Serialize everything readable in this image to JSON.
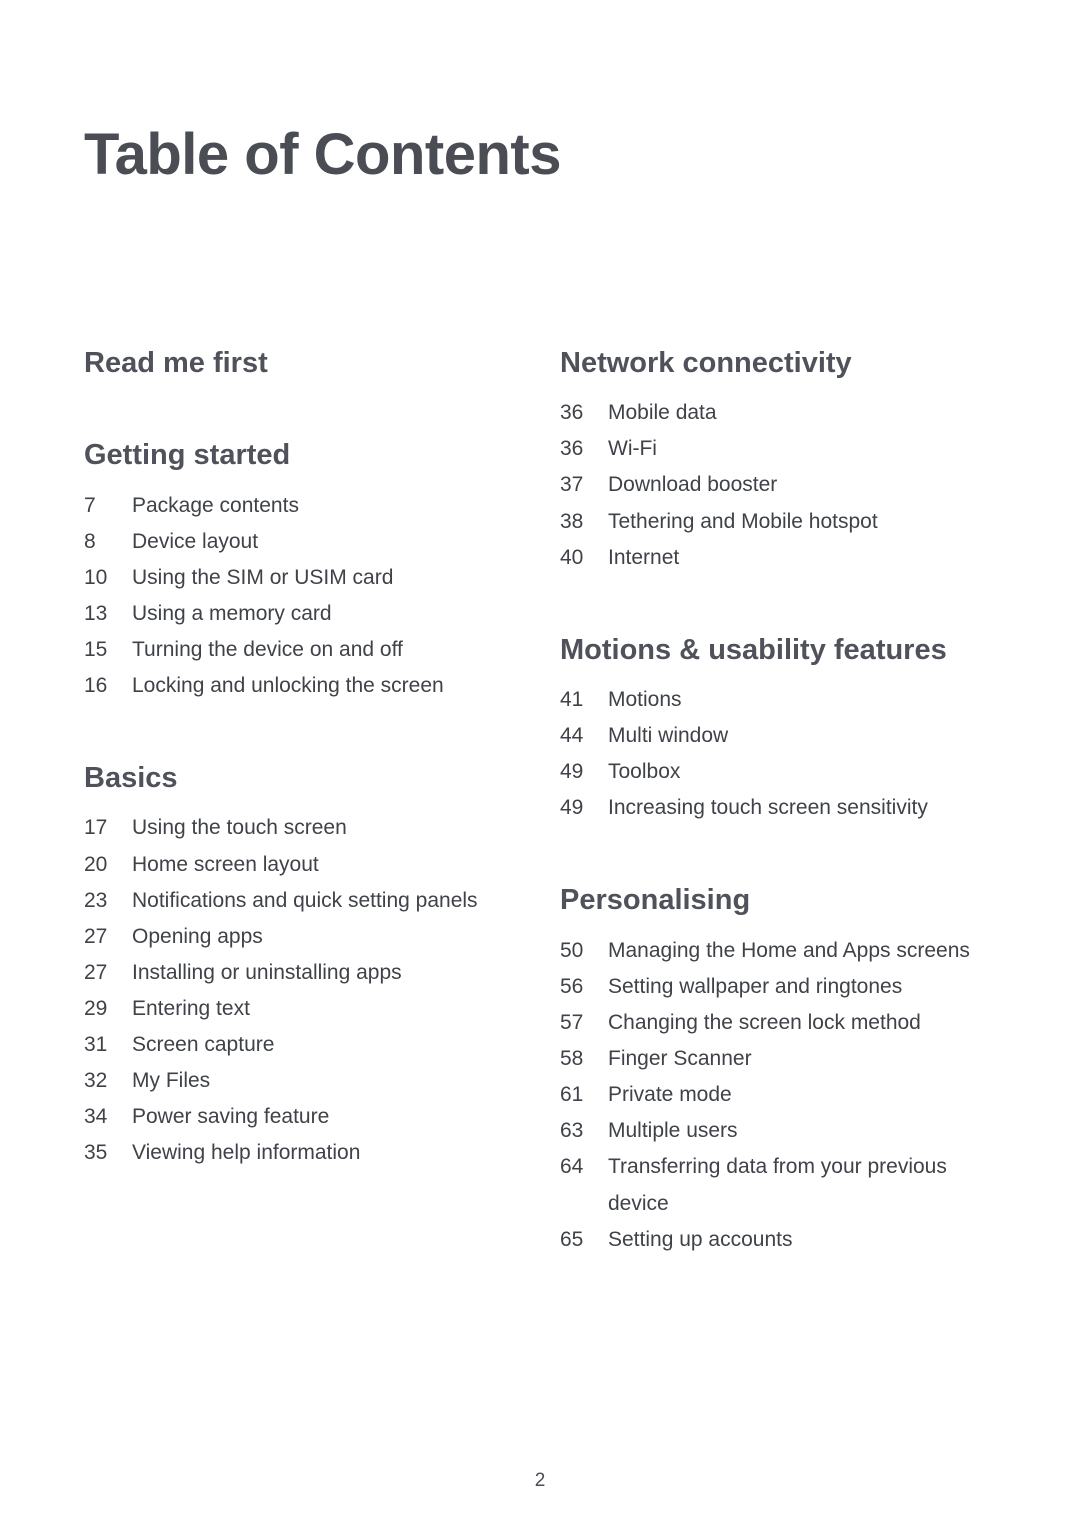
{
  "document": {
    "title": "Table of Contents",
    "page_number": "2"
  },
  "left_column": [
    {
      "heading": "Read me first",
      "entries": []
    },
    {
      "heading": "Getting started",
      "entries": [
        {
          "page": "7",
          "label": "Package contents"
        },
        {
          "page": "8",
          "label": "Device layout"
        },
        {
          "page": "10",
          "label": "Using the SIM or USIM card"
        },
        {
          "page": "13",
          "label": "Using a memory card"
        },
        {
          "page": "15",
          "label": "Turning the device on and off"
        },
        {
          "page": "16",
          "label": "Locking and unlocking the screen"
        }
      ]
    },
    {
      "heading": "Basics",
      "entries": [
        {
          "page": "17",
          "label": "Using the touch screen"
        },
        {
          "page": "20",
          "label": "Home screen layout"
        },
        {
          "page": "23",
          "label": "Notifications and quick setting panels"
        },
        {
          "page": "27",
          "label": "Opening apps"
        },
        {
          "page": "27",
          "label": "Installing or uninstalling apps"
        },
        {
          "page": "29",
          "label": "Entering text"
        },
        {
          "page": "31",
          "label": "Screen capture"
        },
        {
          "page": "32",
          "label": "My Files"
        },
        {
          "page": "34",
          "label": "Power saving feature"
        },
        {
          "page": "35",
          "label": "Viewing help information"
        }
      ]
    }
  ],
  "right_column": [
    {
      "heading": "Network connectivity",
      "entries": [
        {
          "page": "36",
          "label": "Mobile data"
        },
        {
          "page": "36",
          "label": "Wi-Fi"
        },
        {
          "page": "37",
          "label": "Download booster"
        },
        {
          "page": "38",
          "label": "Tethering and Mobile hotspot"
        },
        {
          "page": "40",
          "label": "Internet"
        }
      ]
    },
    {
      "heading": "Motions & usability features",
      "entries": [
        {
          "page": "41",
          "label": "Motions"
        },
        {
          "page": "44",
          "label": "Multi window"
        },
        {
          "page": "49",
          "label": "Toolbox"
        },
        {
          "page": "49",
          "label": "Increasing touch screen sensitivity"
        }
      ]
    },
    {
      "heading": "Personalising",
      "entries": [
        {
          "page": "50",
          "label": "Managing the Home and Apps screens"
        },
        {
          "page": "56",
          "label": "Setting wallpaper and ringtones"
        },
        {
          "page": "57",
          "label": "Changing the screen lock method"
        },
        {
          "page": "58",
          "label": "Finger Scanner"
        },
        {
          "page": "61",
          "label": "Private mode"
        },
        {
          "page": "63",
          "label": "Multiple users"
        },
        {
          "page": "64",
          "label": "Transferring data from your previous",
          "label2": "device"
        },
        {
          "page": "65",
          "label": "Setting up accounts"
        }
      ]
    }
  ]
}
